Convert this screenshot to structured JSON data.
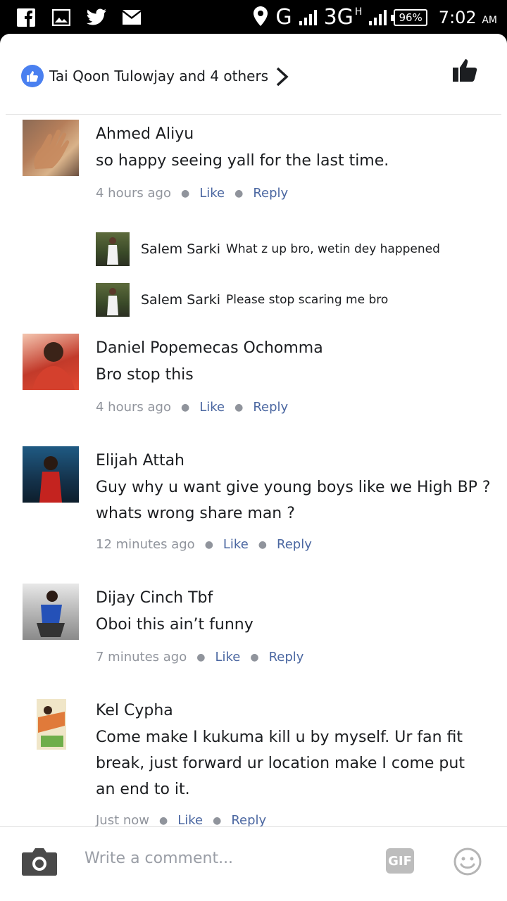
{
  "status_bar": {
    "network": "G",
    "network2": "3G",
    "network2_sup": "H",
    "battery": "96%",
    "time": "7:02",
    "ampm": "AM"
  },
  "header": {
    "reactors": "Tai Qoon Tulowjay and 4 others"
  },
  "comments": [
    {
      "name": "Ahmed Aliyu",
      "text": "so happy seeing yall for the last time.",
      "time": "4 hours ago",
      "like": "Like",
      "reply": "Reply"
    },
    {
      "name": "Daniel Popemecas Ochomma",
      "text": "Bro stop this",
      "time": "4 hours ago",
      "like": "Like",
      "reply": "Reply"
    },
    {
      "name": "Elijah Attah",
      "text": "Guy why u want give young boys like we High BP ?",
      "text2": "whats wrong share man ?",
      "time": "12 minutes ago",
      "like": "Like",
      "reply": "Reply"
    },
    {
      "name": "Dijay Cinch Tbf",
      "text": "Oboi this ain’t funny",
      "time": "7 minutes ago",
      "like": "Like",
      "reply": "Reply"
    },
    {
      "name": "Kel Cypha",
      "text": "Come make I kukuma kill u by myself. Ur fan fit",
      "text2": "break, just forward ur location make I come put",
      "text3": "an end to it.",
      "time": "Just now",
      "like": "Like",
      "reply": "Reply"
    }
  ],
  "replies": [
    {
      "name": "Salem Sarki",
      "text": "What z up bro, wetin dey happened"
    },
    {
      "name": "Salem Sarki",
      "text": "Please stop scaring me bro"
    }
  ],
  "composer": {
    "placeholder": "Write a comment...",
    "gif_label": "GIF"
  }
}
